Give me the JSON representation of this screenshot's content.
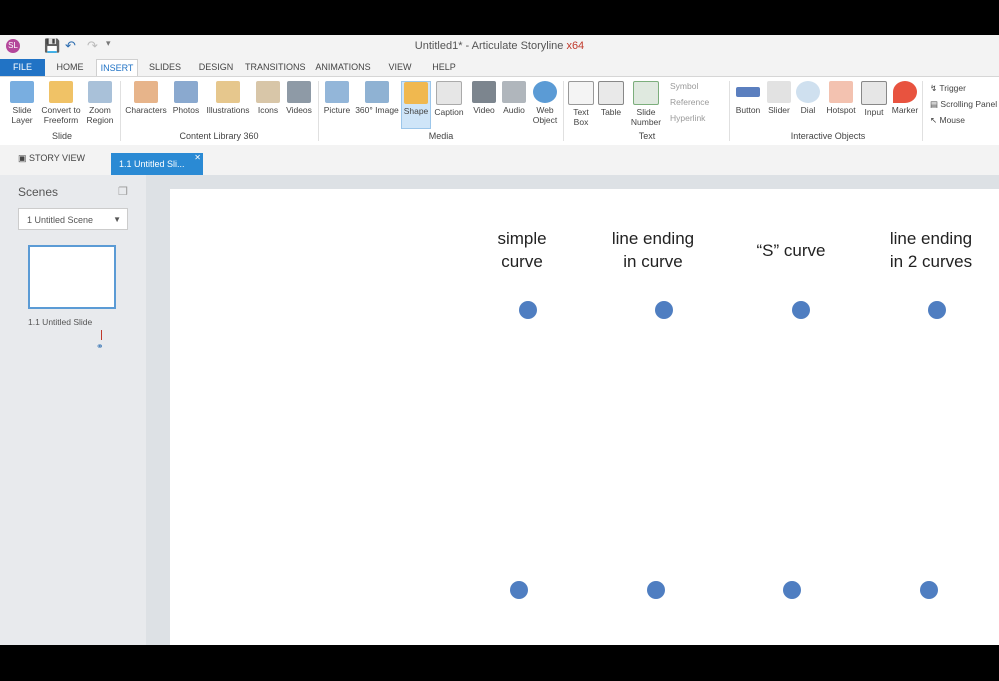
{
  "titlebar": {
    "title": "Untitled1* - Articulate Storyline",
    "arch": "x64"
  },
  "tabs": [
    "FILE",
    "HOME",
    "INSERT",
    "SLIDES",
    "DESIGN",
    "TRANSITIONS",
    "ANIMATIONS",
    "VIEW",
    "HELP"
  ],
  "ribbon": {
    "slide_group": {
      "label": "Slide",
      "buttons": [
        "Slide Layer",
        "Convert to Freeform",
        "Zoom Region"
      ]
    },
    "content_group": {
      "label": "Content Library 360",
      "buttons": [
        "Characters",
        "Photos",
        "Illustrations",
        "Icons",
        "Videos"
      ]
    },
    "media_group": {
      "label": "Media",
      "buttons": [
        "Picture",
        "360° Image",
        "Shape",
        "Caption",
        "Video",
        "Audio",
        "Web Object"
      ]
    },
    "text_group": {
      "label": "Text",
      "buttons": [
        "Text Box",
        "Table",
        "Slide Number"
      ],
      "small": [
        "Symbol",
        "Reference",
        "Hyperlink"
      ]
    },
    "interactive_group": {
      "label": "Interactive Objects",
      "buttons": [
        "Button",
        "Slider",
        "Dial",
        "Hotspot",
        "Input",
        "Marker"
      ],
      "small": [
        "Trigger",
        "Scrolling Panel",
        "Mouse"
      ]
    }
  },
  "doctabs": {
    "story_view": "STORY VIEW",
    "slide_tab": "1.1 Untitled Sli..."
  },
  "left_panel": {
    "title": "Scenes",
    "scene_select": "1 Untitled Scene",
    "thumb_label": "1.1 Untitled Slide"
  },
  "slide": {
    "labels": [
      "simple curve",
      "line ending in curve",
      "“S” curve",
      "line ending in 2 curves"
    ],
    "labels_split": [
      [
        "simple",
        "curve"
      ],
      [
        "line ending",
        "in curve"
      ],
      [
        "“S” curve",
        ""
      ],
      [
        "line ending",
        "in 2 curves"
      ]
    ]
  },
  "colors": {
    "accent": "#2173c5",
    "dot": "#4f7ec1",
    "active_tab": "#2a8ad4"
  }
}
